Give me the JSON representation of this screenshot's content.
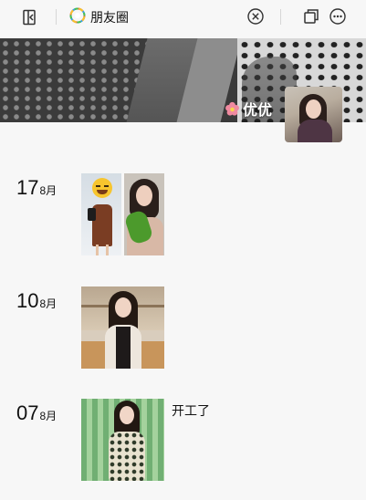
{
  "titlebar": {
    "title": "朋友圈",
    "icons": [
      "back-panel-icon",
      "moments-logo-icon",
      "close-circle-icon",
      "copy-window-icon",
      "more-icon"
    ]
  },
  "profile": {
    "username": "优优"
  },
  "posts": [
    {
      "day": "17",
      "month": "8月",
      "photos": 2,
      "caption": ""
    },
    {
      "day": "10",
      "month": "8月",
      "photos": 1,
      "caption": ""
    },
    {
      "day": "07",
      "month": "8月",
      "photos": 1,
      "caption": "开工了"
    }
  ]
}
